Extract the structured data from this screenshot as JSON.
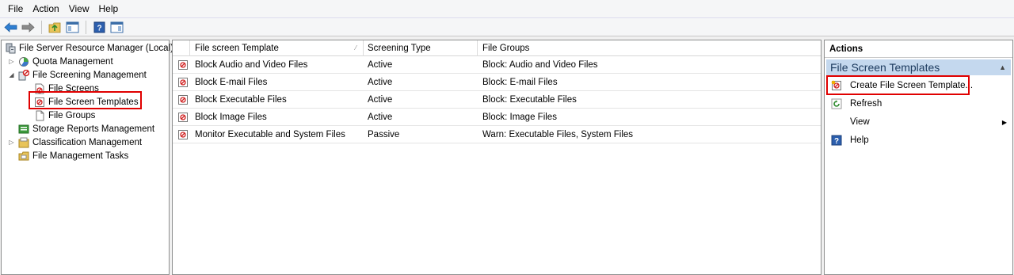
{
  "menu": {
    "items": [
      "File",
      "Action",
      "View",
      "Help"
    ]
  },
  "toolbar": {
    "icons": [
      "back-arrow-icon",
      "forward-arrow-icon",
      "up-folder-icon",
      "show-hide-console-tree-icon",
      "help-icon",
      "show-hide-action-pane-icon"
    ]
  },
  "tree": {
    "root": "File Server Resource Manager (Local)",
    "quota": "Quota Management",
    "screening": "File Screening Management",
    "screens": "File Screens",
    "templates": "File Screen Templates",
    "groups": "File Groups",
    "reports": "Storage Reports Management",
    "classification": "Classification Management",
    "tasks": "File Management Tasks"
  },
  "table": {
    "columns": [
      "File screen Template",
      "Screening Type",
      "File Groups"
    ],
    "rows": [
      {
        "name": "Block Audio and Video Files",
        "type": "Active",
        "groups": "Block: Audio and Video Files"
      },
      {
        "name": "Block E-mail Files",
        "type": "Active",
        "groups": "Block: E-mail Files"
      },
      {
        "name": "Block Executable Files",
        "type": "Active",
        "groups": "Block: Executable Files"
      },
      {
        "name": "Block Image Files",
        "type": "Active",
        "groups": "Block: Image Files"
      },
      {
        "name": "Monitor Executable and System Files",
        "type": "Passive",
        "groups": "Warn: Executable Files, System Files"
      }
    ]
  },
  "actions": {
    "header": "Actions",
    "section": "File Screen Templates",
    "create": "Create File Screen Template...",
    "refresh": "Refresh",
    "view": "View",
    "help": "Help"
  },
  "colors": {
    "accent": "#e00000",
    "section_bg": "#c4d8ee"
  }
}
